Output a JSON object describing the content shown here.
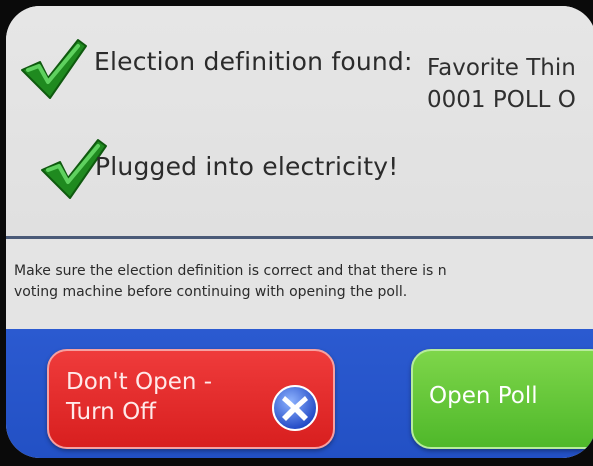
{
  "status": {
    "items": [
      {
        "icon": "check-icon",
        "label": "Election definition found:",
        "value_lines": [
          "Favorite Thin",
          "0001 POLL O"
        ]
      },
      {
        "icon": "check-icon",
        "label": "Plugged into electricity!"
      }
    ]
  },
  "message": {
    "line1": "Make sure the election definition is correct and that there is n",
    "line2": "voting machine before continuing with opening the poll."
  },
  "actions": {
    "dont_open_label": "Don't Open -\nTurn Off",
    "dont_open_icon": "x-circle-icon",
    "open_poll_label": "Open Poll"
  },
  "colors": {
    "check_green": "#1f8a1f",
    "action_bar_blue": "#2b5ad0",
    "turn_off_red": "#e02a2a",
    "open_poll_green": "#5cc234"
  }
}
